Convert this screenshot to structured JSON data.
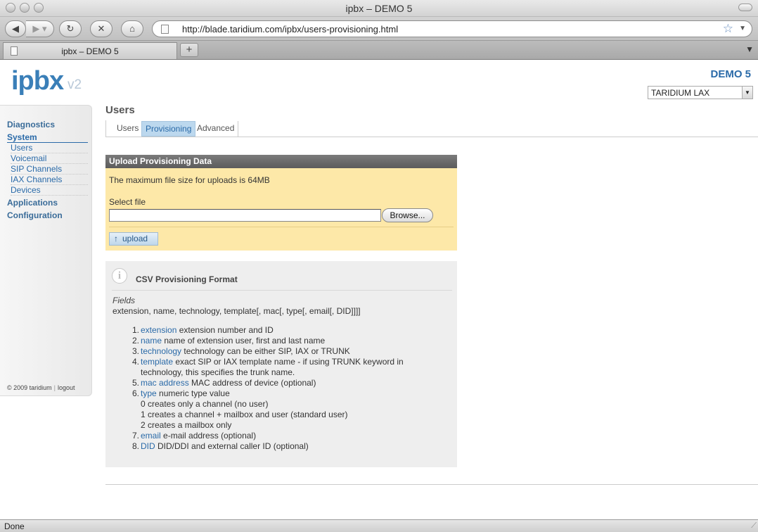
{
  "window": {
    "title": "ipbx – DEMO 5"
  },
  "toolbar": {
    "url": "http://blade.taridium.com/ipbx/users-provisioning.html"
  },
  "tabs_bar": {
    "tab_title": "ipbx – DEMO 5",
    "new_tab": "+"
  },
  "header": {
    "logo": "ipbx",
    "version": "v2",
    "site_name": "DEMO 5",
    "site_select_value": "TARIDIUM LAX"
  },
  "sidebar": {
    "sections": [
      "Diagnostics",
      "System",
      "Applications",
      "Configuration"
    ],
    "system_items": [
      "Users",
      "Voicemail",
      "SIP Channels",
      "IAX Channels",
      "Devices"
    ],
    "footer_copyright": "© 2009 taridium",
    "footer_sep": "|",
    "footer_logout": "logout"
  },
  "main": {
    "title": "Users",
    "tabs": [
      "Users",
      "Provisioning",
      "Advanced"
    ],
    "active_tab": "Provisioning"
  },
  "upload": {
    "heading": "Upload Provisioning Data",
    "note": "The maximum file size for uploads is 64MB",
    "select_label": "Select file",
    "browse_label": "Browse...",
    "upload_label": "upload",
    "upload_arrow": "↑"
  },
  "info": {
    "icon": "i",
    "title": "CSV Provisioning Format",
    "fields_label": "Fields",
    "fields_syntax": "extension, name, technology, template[, mac[, type[, email[, DID]]]]",
    "items": [
      {
        "num": "1.",
        "key": "extension",
        "text": "extension number and ID"
      },
      {
        "num": "2.",
        "key": "name",
        "text": "name of extension user, first and last name"
      },
      {
        "num": "3.",
        "key": "technology",
        "text": "technology can be either SIP, IAX or TRUNK"
      },
      {
        "num": "4.",
        "key": "template",
        "text": "exact SIP or IAX template name - if using TRUNK keyword in technology, this specifies the trunk name."
      },
      {
        "num": "5.",
        "key": "mac address",
        "text": "MAC address of device (optional)"
      },
      {
        "num": "6.",
        "key": "type",
        "text": "numeric type value"
      },
      {
        "num": "7.",
        "key": "email",
        "text": "e-mail address (optional)"
      },
      {
        "num": "8.",
        "key": "DID",
        "text": "DID/DDI and external caller ID (optional)"
      }
    ],
    "type_values": [
      "0 creates only a channel (no user)",
      "1 creates a channel + mailbox and user (standard user)",
      "2 creates a mailbox only"
    ]
  },
  "status": {
    "text": "Done"
  },
  "colors": {
    "accent": "#2a6aa8",
    "upload_panel": "#fde8a8",
    "info_panel": "#eeeeee",
    "active_tab": "#bcd8ee"
  },
  "icons": [
    "back-icon",
    "forward-icon",
    "reload-icon",
    "stop-icon",
    "home-icon",
    "page-icon",
    "bookmark-star-icon",
    "info-icon",
    "upload-arrow-icon"
  ]
}
